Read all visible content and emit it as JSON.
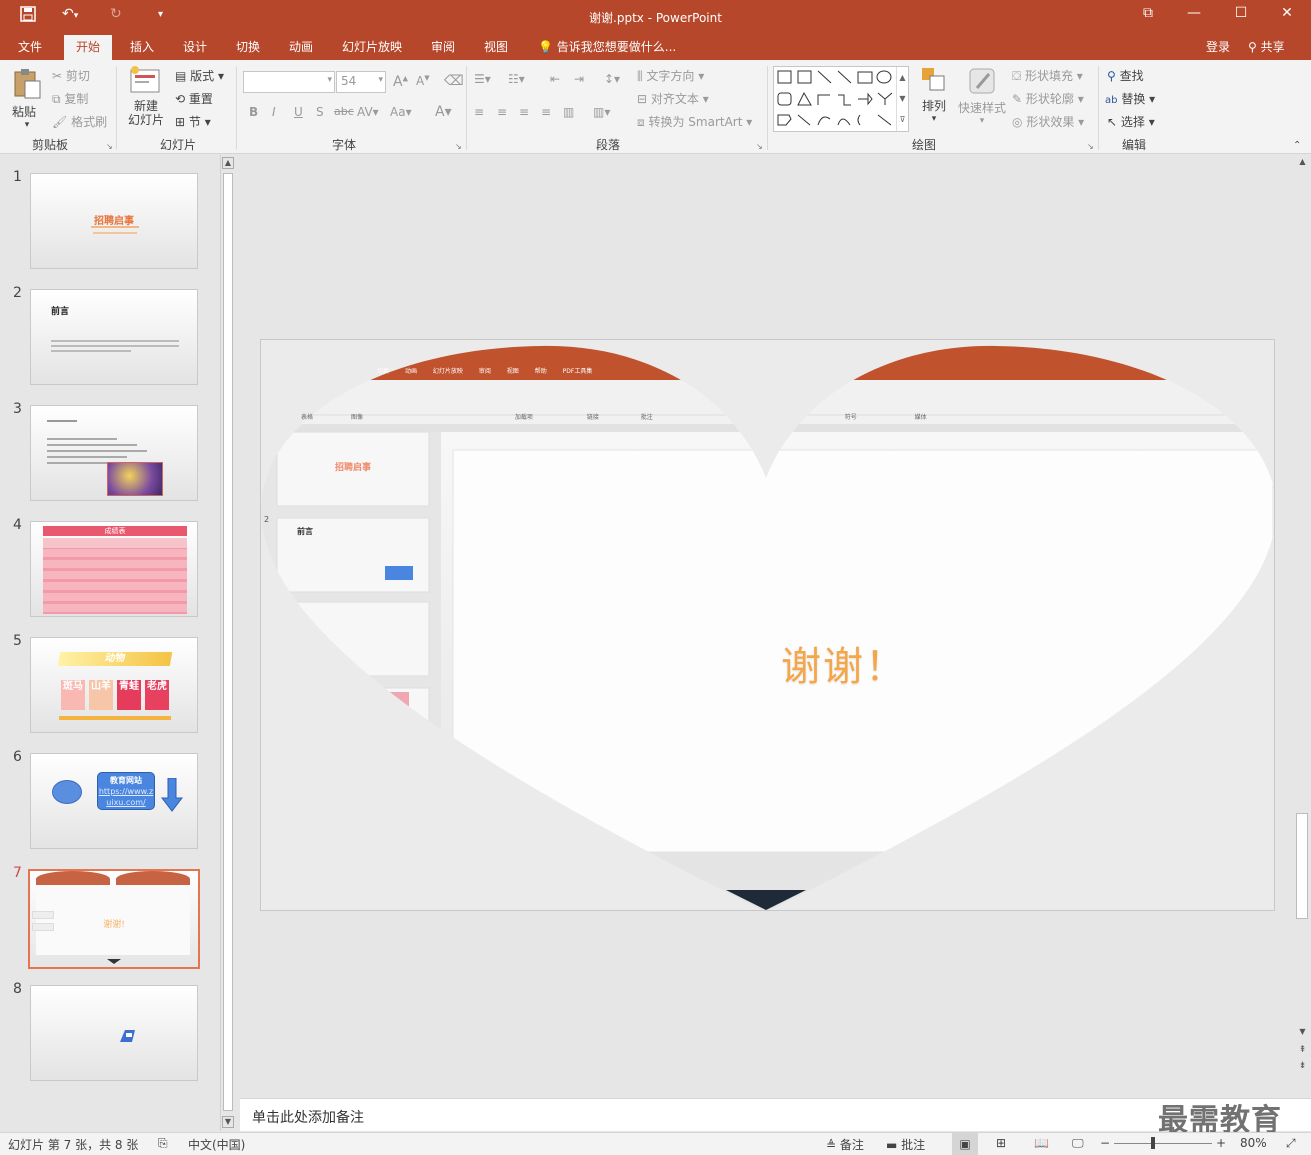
{
  "titlebar": {
    "title": "谢谢.pptx - PowerPoint"
  },
  "tabs": [
    "文件",
    "开始",
    "插入",
    "设计",
    "切换",
    "动画",
    "幻灯片放映",
    "审阅",
    "视图"
  ],
  "tell_me": "告诉我您想要做什么...",
  "account": {
    "login": "登录",
    "share": "共享"
  },
  "ribbon": {
    "clipboard": {
      "paste": "粘贴",
      "cut": "剪切",
      "copy": "复制",
      "format_painter": "格式刷",
      "label": "剪贴板"
    },
    "slides": {
      "new_slide": "新建\n幻灯片",
      "layout": "版式",
      "reset": "重置",
      "section": "节",
      "label": "幻灯片"
    },
    "font": {
      "name": "",
      "size": "54",
      "label": "字体"
    },
    "paragraph": {
      "text_direction": "文字方向",
      "align_text": "对齐文本",
      "convert_smartart": "转换为 SmartArt",
      "label": "段落"
    },
    "drawing": {
      "arrange": "排列",
      "quick_styles": "快速样式",
      "shape_fill": "形状填充",
      "shape_outline": "形状轮廓",
      "shape_effects": "形状效果",
      "label": "绘图"
    },
    "editing": {
      "find": "查找",
      "replace": "替换",
      "select": "选择",
      "label": "编辑"
    }
  },
  "thumbnails": [
    {
      "num": "1",
      "title": "招聘启事"
    },
    {
      "num": "2",
      "title": "前言"
    },
    {
      "num": "3",
      "title": ""
    },
    {
      "num": "4",
      "title": "成绩表"
    },
    {
      "num": "5",
      "title": "动物",
      "cells": [
        "斑马",
        "山羊",
        "青蛙",
        "老虎"
      ]
    },
    {
      "num": "6",
      "title": "教育网站",
      "url": "https://www.zuixu.com/"
    },
    {
      "num": "7",
      "title": "谢谢!"
    },
    {
      "num": "8",
      "title": ""
    }
  ],
  "slide": {
    "text": "谢谢！",
    "inner_tabs": [
      "切换",
      "动画",
      "幻灯片放映",
      "审阅",
      "视图",
      "帮助",
      "PDF工具集"
    ],
    "inner_groups": [
      "表格",
      "图像",
      "加载项",
      "链接",
      "批注",
      "符号",
      "媒体"
    ],
    "inner_thumb1": "招聘启事",
    "inner_thumb2": "前言",
    "inner_num": "2"
  },
  "notes_placeholder": "单击此处添加备注",
  "status": {
    "slide_info": "幻灯片 第 7 张，共 8 张",
    "language": "中文(中国)",
    "notes": "备注",
    "comments": "批注",
    "zoom": "80%"
  },
  "watermark": "最需教育",
  "colors": {
    "brand": "#b7472a",
    "selected_border": "#e5754e",
    "orange_text": "#f4a64a"
  }
}
